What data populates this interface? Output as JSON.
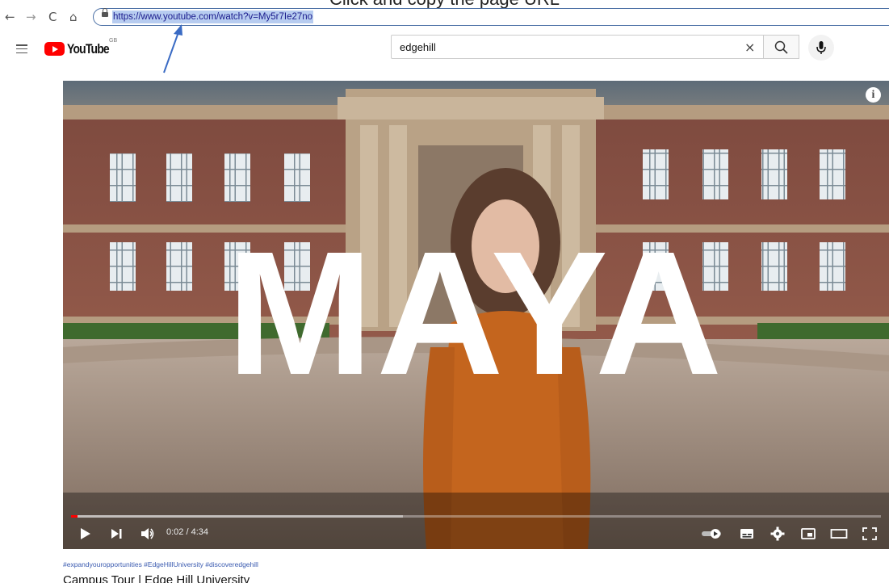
{
  "instruction": "Click and copy the page URL",
  "browser": {
    "url": "https://www.youtube.com/watch?v=My5r7Ie27no",
    "back_icon": "←",
    "forward_icon": "→",
    "reload_icon": "C",
    "home_icon": "⌂"
  },
  "youtube": {
    "logo_text": "YouTube",
    "region": "GB",
    "search_value": "edgehill",
    "clear_icon": "×"
  },
  "player": {
    "overlay_text": "MAYA",
    "info_label": "i",
    "time": "0:02 / 4:34",
    "played_fraction": 0.008,
    "loaded_fraction": 0.41
  },
  "video": {
    "hashtags": "#expandyouropportunities #EdgeHillUniversity #discoveredgehill",
    "title": "Campus Tour | Edge Hill University"
  },
  "colors": {
    "accent": "#ff0000",
    "link": "#3b5bb0",
    "url_highlight": "#b7ccf0"
  }
}
